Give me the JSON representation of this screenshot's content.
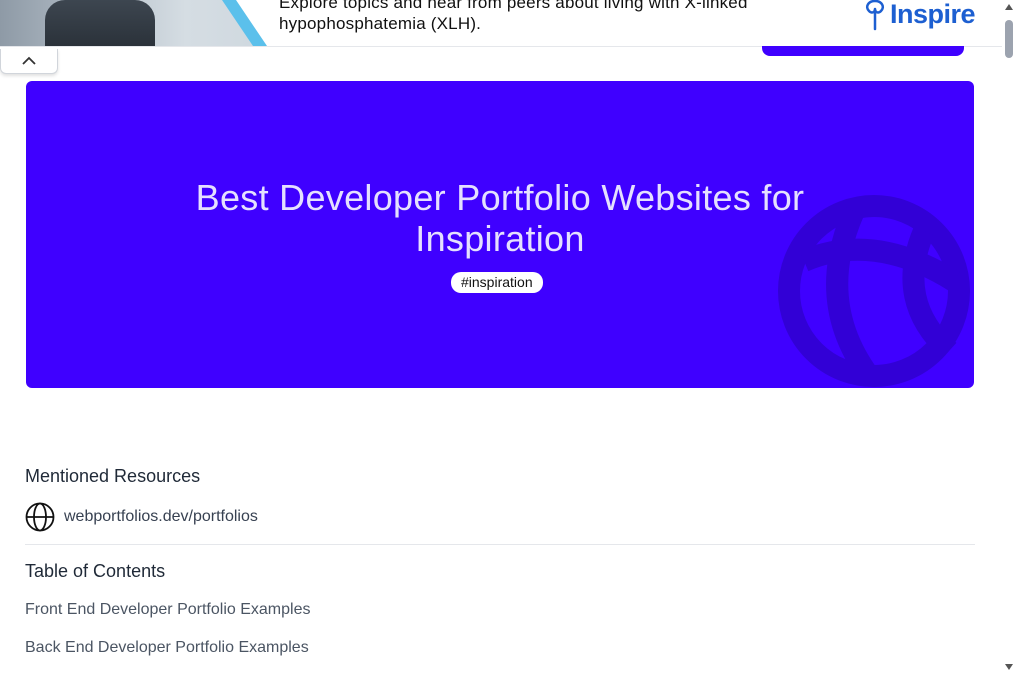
{
  "ad": {
    "text_line1": "Explore topics and hear from peers about living with X-linked",
    "text_line2": "hypophosphatemia (XLH).",
    "logo_text": "Inspire"
  },
  "hero": {
    "title_line1": "Best Developer Portfolio Websites for",
    "title_line2": "Inspiration",
    "tag": "#inspiration",
    "background_color": "#3f00ff"
  },
  "resources": {
    "heading": "Mentioned Resources",
    "items": [
      {
        "icon": "globe-icon",
        "label": "webportfolios.dev/portfolios"
      }
    ]
  },
  "toc": {
    "heading": "Table of Contents",
    "items": [
      "Front End Developer Portfolio Examples",
      "Back End Developer Portfolio Examples"
    ]
  }
}
